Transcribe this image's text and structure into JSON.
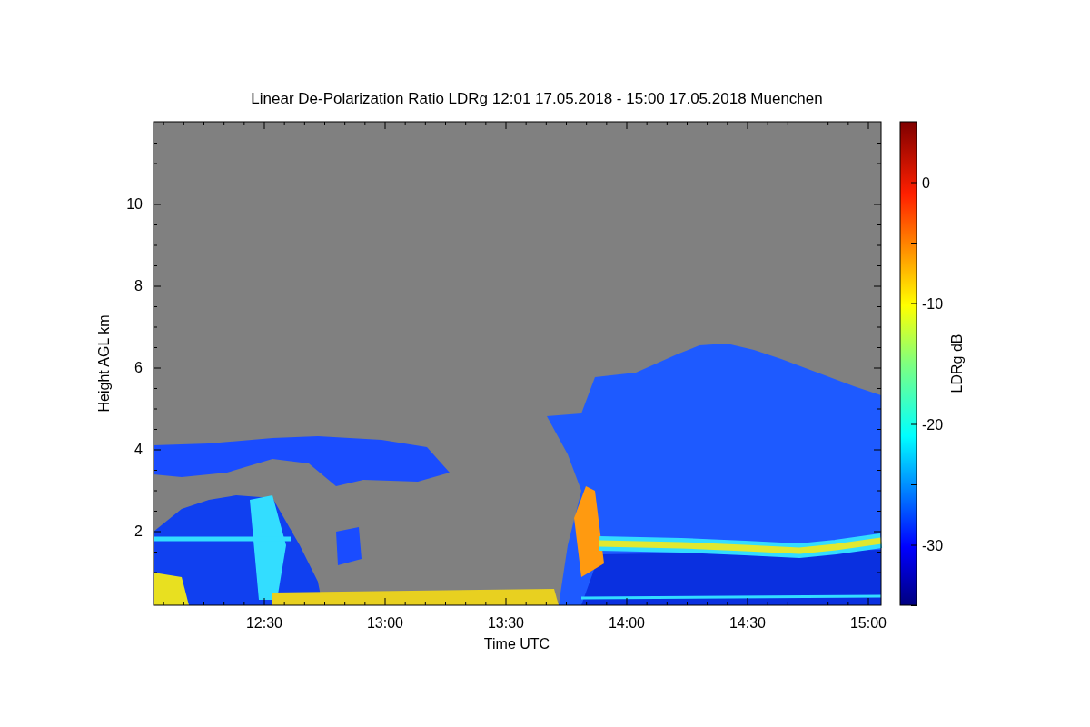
{
  "title": "Linear De-Polarization Ratio LDRg   12:01 17.05.2018 - 15:00 17.05.2018 Muenchen",
  "y_axis": {
    "label": "Height AGL km",
    "ticks": [
      "10",
      "8",
      "6",
      "4",
      "2"
    ]
  },
  "x_axis": {
    "label": "Time UTC",
    "ticks": [
      "12:30",
      "13:00",
      "13:30",
      "14:00",
      "14:30",
      "15:00"
    ]
  },
  "colorbar": {
    "label": "LDRg dB",
    "ticks": [
      "0",
      "-10",
      "-20",
      "-30"
    ]
  }
}
